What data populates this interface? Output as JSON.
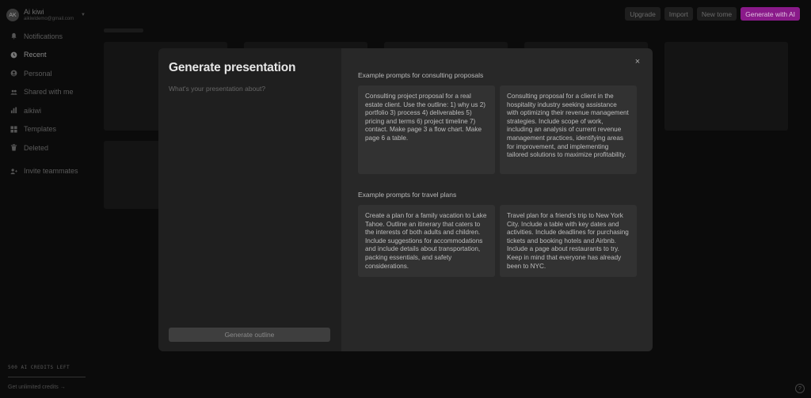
{
  "account": {
    "initials": "AK",
    "name": "Ai kiwi",
    "email": "aikiwidemo@gmail.com"
  },
  "sidebar": {
    "items": [
      {
        "label": "Notifications",
        "icon": "bell-icon"
      },
      {
        "label": "Recent",
        "icon": "clock-icon"
      },
      {
        "label": "Personal",
        "icon": "person-icon"
      },
      {
        "label": "Shared with me",
        "icon": "people-icon"
      },
      {
        "label": "aikiwi",
        "icon": "chart-icon"
      },
      {
        "label": "Templates",
        "icon": "grid-icon"
      },
      {
        "label": "Deleted",
        "icon": "trash-icon"
      },
      {
        "label": "Invite teammates",
        "icon": "add-person-icon"
      }
    ],
    "credits_label": "500 AI CREDITS LEFT",
    "unlimited_label": "Get unlimited credits →"
  },
  "topbar": {
    "upgrade": "Upgrade",
    "import": "Import",
    "new_tome": "New tome",
    "generate_ai": "Generate with AI"
  },
  "modal": {
    "title": "Generate presentation",
    "input_placeholder": "What's your presentation about?",
    "generate_button": "Generate outline",
    "close_icon": "×",
    "sections": [
      {
        "label": "Example prompts for consulting proposals",
        "prompts": [
          "Consulting project proposal for a real estate client. Use the outline: 1) why us 2) portfolio 3) process 4) deliverables 5) pricing and terms 6) project timeline 7) contact. Make page 3 a flow chart. Make page 6 a table.",
          "Consulting proposal for a client in the hospitality industry seeking assistance with optimizing their revenue management strategies. Include scope of work, including an analysis of current revenue management practices, identifying areas for improvement, and implementing tailored solutions to maximize profitability."
        ]
      },
      {
        "label": "Example prompts for travel plans",
        "prompts": [
          "Create a plan for a family vacation to Lake Tahoe. Outline an itinerary that caters to the interests of both adults and children. Include suggestions for accommodations and include details about transportation, packing essentials, and safety considerations.",
          "Travel plan for a friend's trip to New York City. Include a table with key dates and activities. Include deadlines for purchasing tickets and booking hotels and Airbnb. Include a page about restaurants to try. Keep in mind that everyone has already been to NYC."
        ]
      }
    ]
  },
  "help_icon": "?",
  "colors": {
    "accent": "#8a1a8a",
    "modal_left": "#1f1f1f",
    "modal_right": "#282828",
    "card": "#323232"
  }
}
